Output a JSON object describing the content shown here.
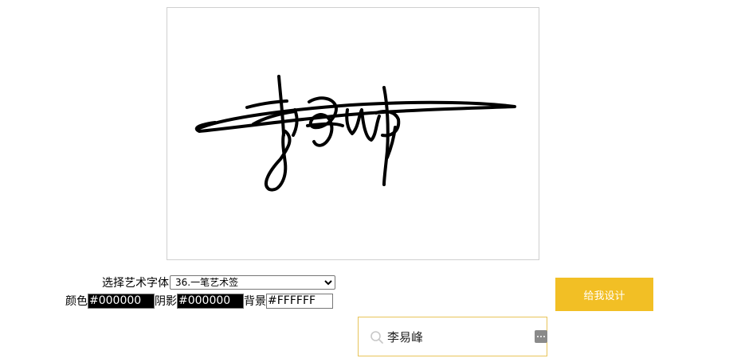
{
  "preview": {
    "signature_text": "李易峰"
  },
  "font_selector": {
    "label": "选择艺术字体",
    "selected": "36.一笔艺术签"
  },
  "colors": {
    "color_label": "颜色",
    "color_value": "#000000",
    "shadow_label": "阴影",
    "shadow_value": "#000000",
    "background_label": "背景",
    "background_value": "#FFFFFF"
  },
  "design_button": {
    "label": "给我设计",
    "color": "#f2bf25"
  },
  "name_input": {
    "value": "李易峰",
    "icon_left": "search-icon",
    "icon_right": "more-icon"
  }
}
